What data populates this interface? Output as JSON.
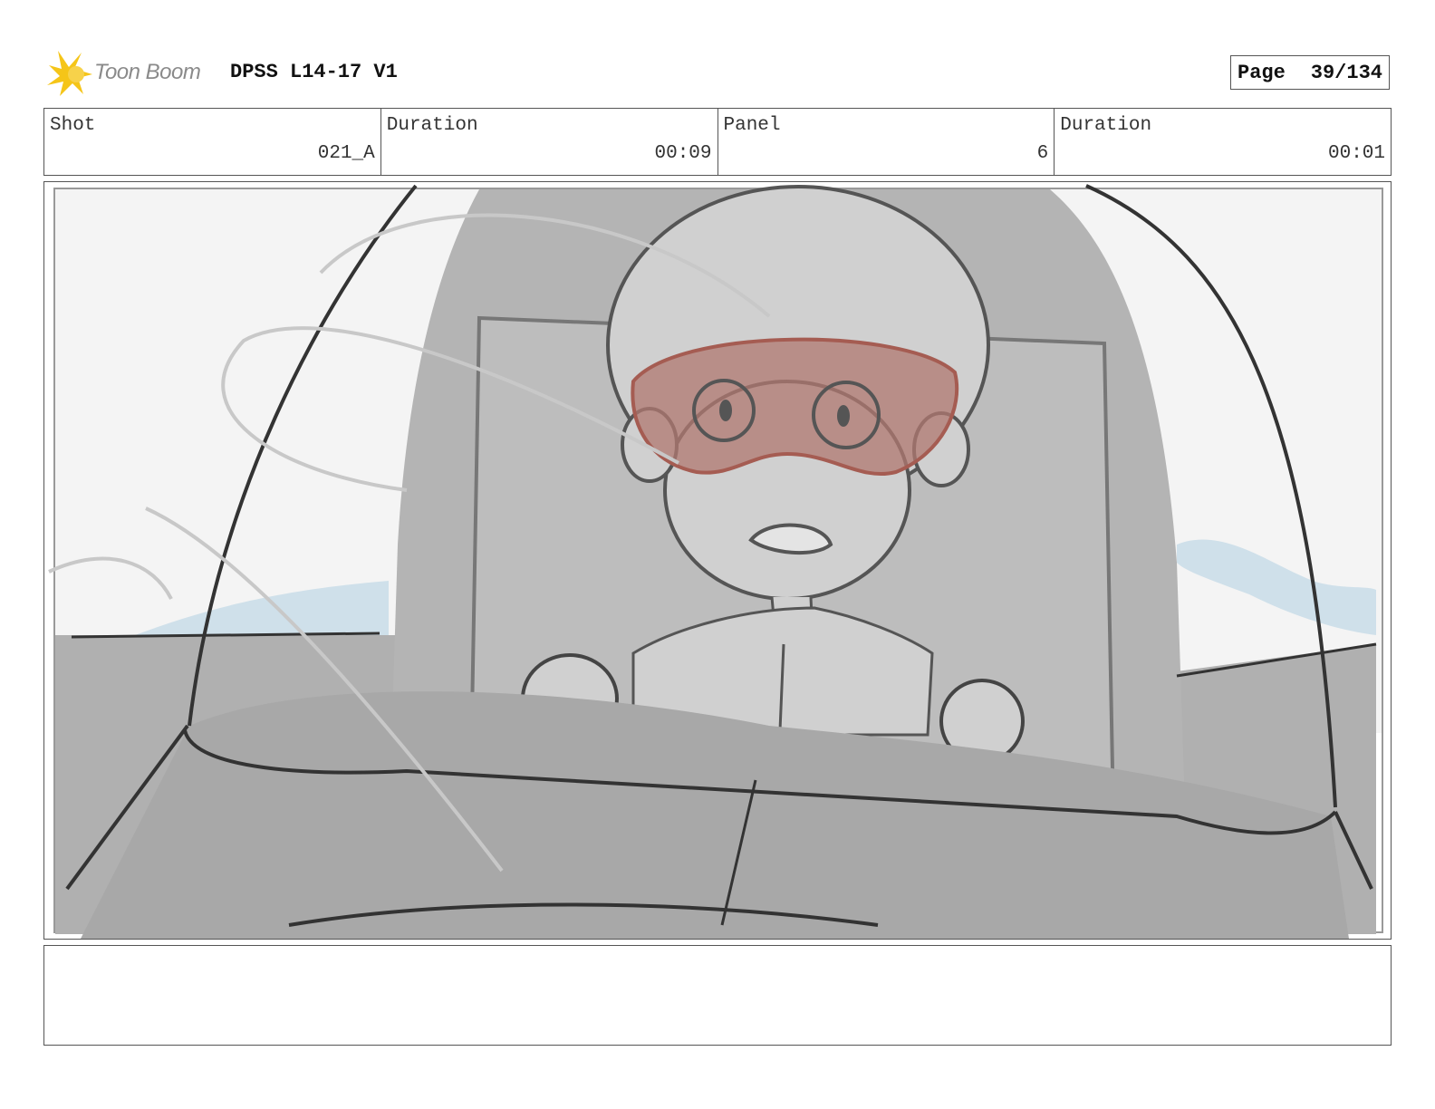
{
  "header": {
    "logo_text": "Toon Boom",
    "project_title": "DPSS L14-17 V1",
    "page_label": "Page",
    "page_number": "39/134"
  },
  "info": {
    "shot_label": "Shot",
    "shot_value": "021_A",
    "shot_duration_label": "Duration",
    "shot_duration_value": "00:09",
    "panel_label": "Panel",
    "panel_value": "6",
    "panel_duration_label": "Duration",
    "panel_duration_value": "00:01"
  },
  "colors": {
    "logo_star": "#f5c518",
    "goggles": "#b07870",
    "sky_blue": "#cfe0ea",
    "sketch_grey": "#b4b4b4"
  },
  "notes": ""
}
